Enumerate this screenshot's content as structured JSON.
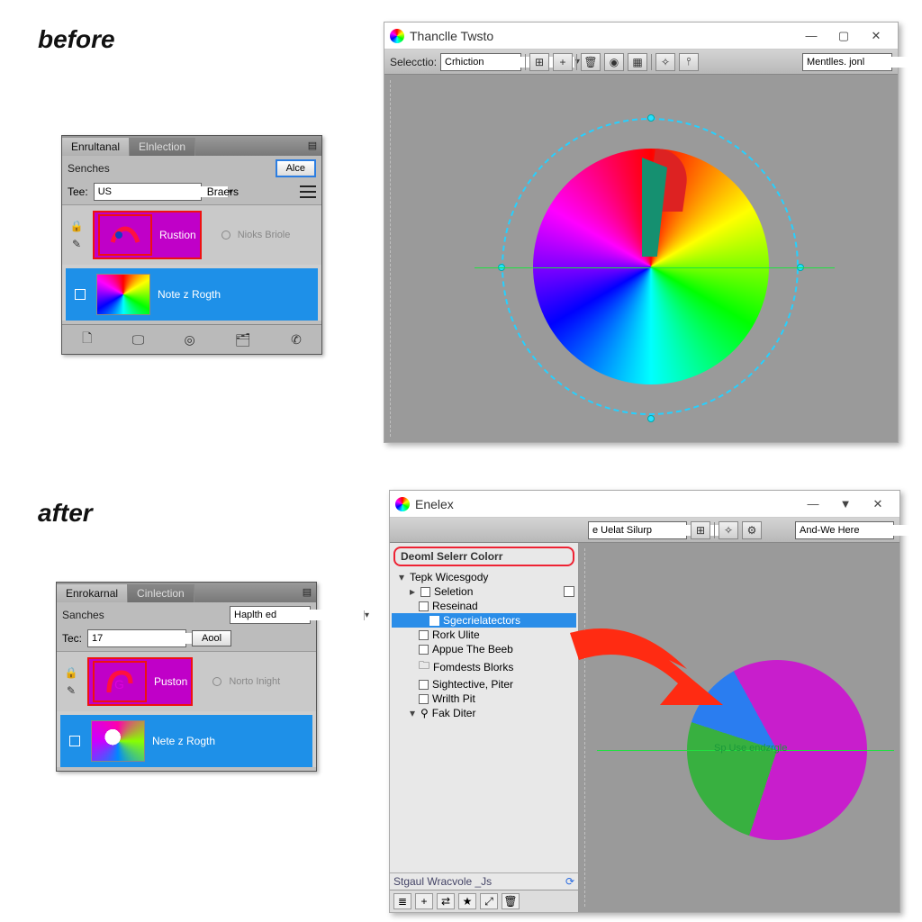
{
  "headings": {
    "before": "before",
    "after": "after"
  },
  "panelBefore": {
    "tabs": {
      "active": "Enrultanal",
      "inactive": "Elnlection"
    },
    "swatchesLabel": "Senches",
    "primaryBtn": "Alce",
    "teeLabel": "Tee:",
    "teeValue": "US",
    "braersLabel": "Braers",
    "items": [
      {
        "label": "Rustion",
        "sub": "Nioks Briole"
      },
      {
        "label": "Note z Rogth"
      }
    ]
  },
  "panelAfter": {
    "tabs": {
      "active": "Enrokarnal",
      "inactive": "Cinlection"
    },
    "swatchesLabel": "Sanches",
    "primaryBtn": "Haplth ed",
    "teeLabel": "Tec:",
    "teeValue": "17",
    "aoolBtn": "Aool",
    "items": [
      {
        "label": "Puston",
        "sub": "Norto Inight"
      },
      {
        "label": "Nete z Rogth"
      }
    ]
  },
  "winBefore": {
    "title": "Thanclle Twsto",
    "toolbarLabel": "Selecctio:",
    "toolbarCombo": "Crhiction",
    "rightCombo": "Mentlles. jonl"
  },
  "winAfter": {
    "title": "Enelex",
    "treeTitle": "Deoml Selerr Colorr",
    "treeRoot": "Tepk Wicesgody",
    "nodes": {
      "n1": "Seletion",
      "n2": "Reseinad",
      "n3": "Sgecrielatectors",
      "n4": "Rork Ulite",
      "n5": "Appue The Beeb",
      "n6": "Fomdests Blorks",
      "n7": "Sightective, Piter",
      "n8": "Wrilth Pit",
      "n9": "Fak Diter"
    },
    "status": "Stgaul Wracvole _Js",
    "toolbarCombo": "e Uelat Silurp",
    "rightCombo": "And-We Here",
    "pieLabel": "Sp Use endzrgle"
  }
}
